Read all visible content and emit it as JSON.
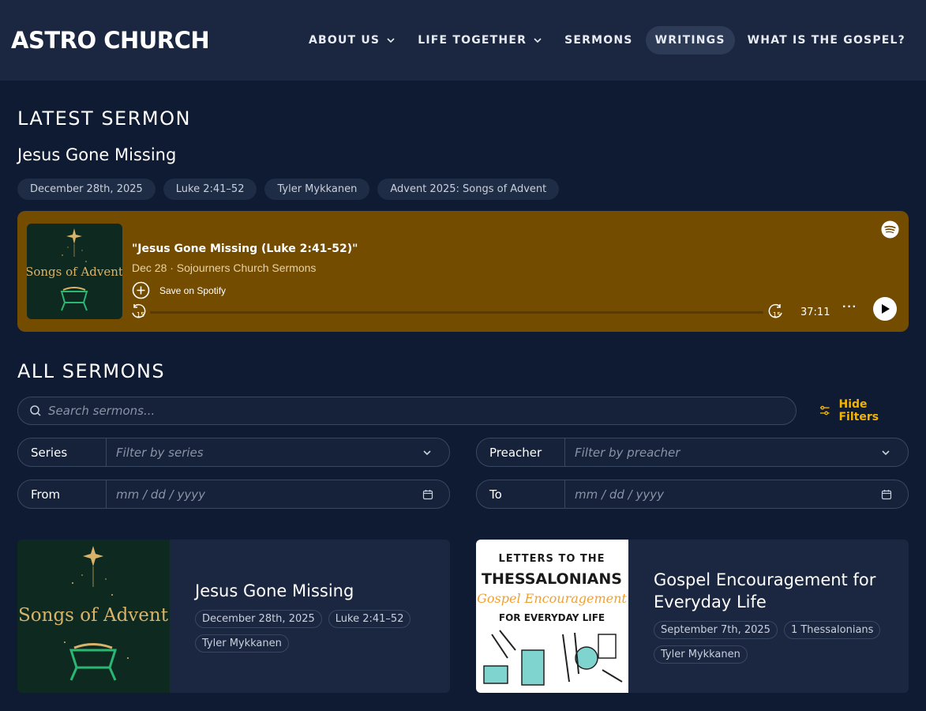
{
  "header": {
    "logo": "ASTRO CHURCH",
    "nav": [
      {
        "label": "ABOUT US",
        "dropdown": true,
        "active": false
      },
      {
        "label": "LIFE TOGETHER",
        "dropdown": true,
        "active": false
      },
      {
        "label": "SERMONS",
        "dropdown": false,
        "active": false
      },
      {
        "label": "WRITINGS",
        "dropdown": false,
        "active": true
      },
      {
        "label": "WHAT IS THE GOSPEL?",
        "dropdown": false,
        "active": false
      }
    ]
  },
  "latest": {
    "heading": "LATEST SERMON",
    "title": "Jesus Gone Missing",
    "tags": [
      "December 28th, 2025",
      "Luke 2:41–52",
      "Tyler Mykkanen",
      "Advent 2025: Songs of Advent"
    ]
  },
  "player": {
    "title": "\"Jesus Gone Missing (Luke 2:41-52)\"",
    "subtitle": "Dec 28 · Sojourners Church Sermons",
    "save_label": "Save on Spotify",
    "duration": "37:11",
    "progress": 0,
    "cover_text": "Songs of Advent",
    "rewind_label": "15",
    "forward_label": "15",
    "bg_color": "#744c00"
  },
  "all": {
    "heading": "ALL SERMONS",
    "search_placeholder": "Search sermons...",
    "hide_filters": "Hide Filters",
    "filters": {
      "series_label": "Series",
      "series_placeholder": "Filter by series",
      "preacher_label": "Preacher",
      "preacher_placeholder": "Filter by preacher",
      "from_label": "From",
      "to_label": "To",
      "date_placeholder": "mm / dd / yyyy"
    }
  },
  "cards": [
    {
      "title": "Jesus Gone Missing",
      "tags": [
        "December 28th, 2025",
        "Luke 2:41–52",
        "Tyler Mykkanen"
      ],
      "cover": {
        "text": "Songs of Advent"
      }
    },
    {
      "title": "Gospel Encouragement for Everyday Life",
      "tags": [
        "September 7th, 2025",
        "1 Thessalonians",
        "Tyler Mykkanen"
      ],
      "cover": {
        "line1": "LETTERS TO THE",
        "line2": "THESSALONIANS",
        "line3": "Gospel Encouragement",
        "line4": "FOR EVERYDAY LIFE"
      }
    }
  ],
  "colors": {
    "accent": "#f5b400",
    "header_bg": "#1b2740",
    "page_bg": "#0f1a33"
  }
}
